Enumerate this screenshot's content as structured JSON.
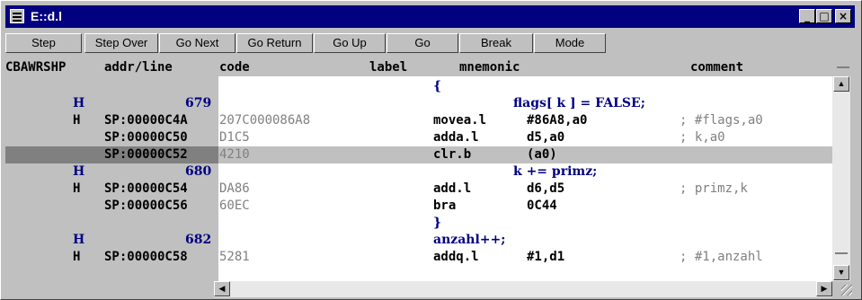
{
  "window": {
    "title": "E::d.l"
  },
  "toolbar": {
    "buttons": [
      "Step",
      "Step Over",
      "Go Next",
      "Go Return",
      "Go Up",
      "Go",
      "Break",
      "Mode"
    ]
  },
  "columns": [
    "CBAWRSHP",
    "addr/line",
    "code",
    "label",
    "mnemonic",
    "comment"
  ],
  "rows": [
    {
      "flag": "",
      "addr": "",
      "code": "",
      "src": "{",
      "mnemonic": "",
      "operand": "",
      "comment": ""
    },
    {
      "flag": "H",
      "addr": "679",
      "code": "",
      "src": "flags[ k ] = FALSE;",
      "mnemonic": "",
      "operand": "",
      "comment": ""
    },
    {
      "flag": "H",
      "addr": "SP:00000C4A",
      "code": "207C000086A8",
      "src": "",
      "mnemonic": "movea.l",
      "operand": "#86A8,a0",
      "comment": "; #flags,a0"
    },
    {
      "flag": "",
      "addr": "SP:00000C50",
      "code": "D1C5",
      "src": "",
      "mnemonic": "adda.l",
      "operand": "d5,a0",
      "comment": "; k,a0"
    },
    {
      "flag": "",
      "addr": "SP:00000C52",
      "code": "4210",
      "src": "",
      "mnemonic": "clr.b",
      "operand": "(a0)",
      "comment": ""
    },
    {
      "flag": "H",
      "addr": "680",
      "code": "",
      "src": "k += primz;",
      "mnemonic": "",
      "operand": "",
      "comment": ""
    },
    {
      "flag": "H",
      "addr": "SP:00000C54",
      "code": "DA86",
      "src": "",
      "mnemonic": "add.l",
      "operand": "d6,d5",
      "comment": "; primz,k"
    },
    {
      "flag": "",
      "addr": "SP:00000C56",
      "code": "60EC",
      "src": "",
      "mnemonic": "bra",
      "operand": "0C44",
      "comment": ""
    },
    {
      "flag": "",
      "addr": "",
      "code": "",
      "src": "}",
      "mnemonic": "",
      "operand": "",
      "comment": ""
    },
    {
      "flag": "H",
      "addr": "682",
      "code": "",
      "src": "anzahl++;",
      "mnemonic": "",
      "operand": "",
      "comment": ""
    },
    {
      "flag": "H",
      "addr": "SP:00000C58",
      "code": "5281",
      "src": "",
      "mnemonic": "addq.l",
      "operand": "#1,d1",
      "comment": "; #1,anzahl"
    }
  ]
}
